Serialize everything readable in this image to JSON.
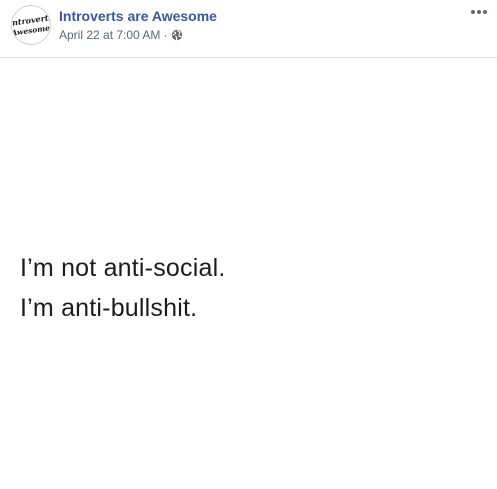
{
  "post": {
    "page_name": "Introverts are Awesome",
    "timestamp": "April 22 at 7:00 AM",
    "separator": "·",
    "privacy_icon": "globe-icon",
    "more_icon": "more-options-icon",
    "avatar_text": [
      "Introverts",
      "Awesome"
    ]
  },
  "image": {
    "lines": [
      "I’m not anti-social.",
      "I’m anti-bullshit."
    ]
  },
  "colors": {
    "page_name": "#385898",
    "meta": "#616770",
    "quote_text": "#1c1c1c",
    "divider": "#e4e6eb"
  }
}
